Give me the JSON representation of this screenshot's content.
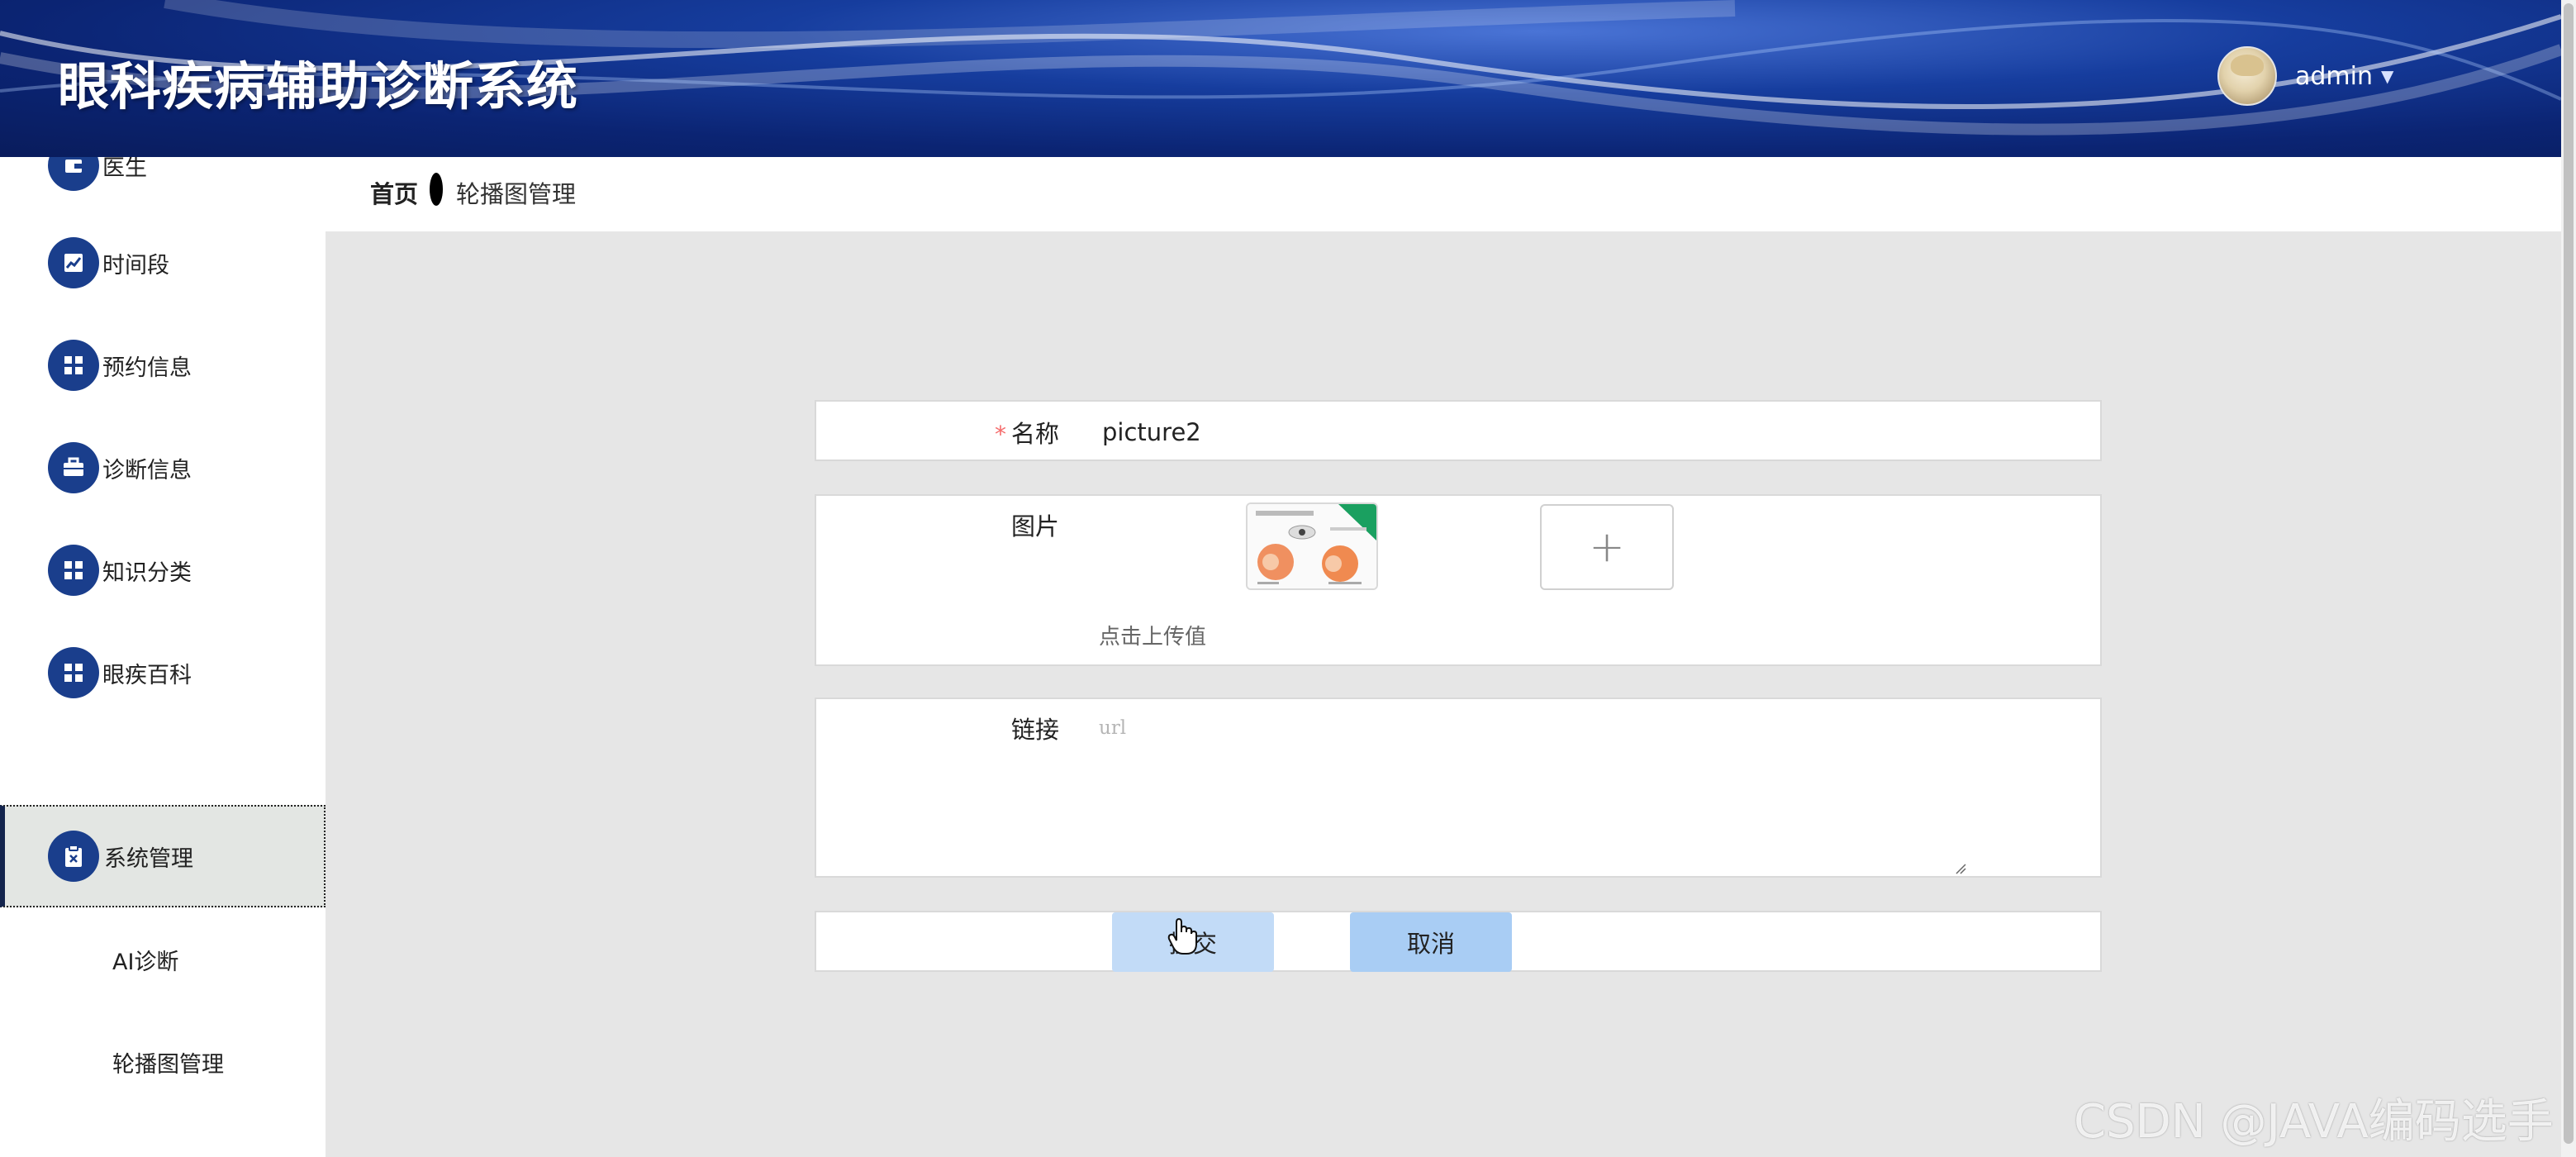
{
  "header": {
    "title": "眼科疾病辅助诊断系统",
    "username": "admin"
  },
  "sidebar": {
    "items": [
      {
        "label": "医生",
        "icon": "wallet-icon"
      },
      {
        "label": "时间段",
        "icon": "chart-icon"
      },
      {
        "label": "预约信息",
        "icon": "grid-icon"
      },
      {
        "label": "诊断信息",
        "icon": "briefcase-icon"
      },
      {
        "label": "知识分类",
        "icon": "grid-icon"
      },
      {
        "label": "眼疾百科",
        "icon": "grid-icon"
      },
      {
        "label": "系统管理",
        "icon": "clipboard-icon",
        "active": true
      }
    ],
    "sub_items": [
      {
        "label": "AI诊断"
      },
      {
        "label": "轮播图管理"
      }
    ]
  },
  "breadcrumb": {
    "home": "首页",
    "current": "轮播图管理"
  },
  "form": {
    "name_label": "名称",
    "name_required_mark": "*",
    "name_value": "picture2",
    "image_label": "图片",
    "upload_plus": "+",
    "upload_hint": "点击上传值",
    "link_label": "链接",
    "link_placeholder": "url",
    "submit_label": "提交",
    "cancel_label": "取消"
  },
  "watermark": "CSDN @JAVA编码选手",
  "colors": {
    "header_blue": "#0b2473",
    "icon_circle": "#1a3e8c",
    "submit_bg": "#c2dbf7",
    "cancel_bg": "#a9cdf4",
    "required": "#f56c6c"
  }
}
